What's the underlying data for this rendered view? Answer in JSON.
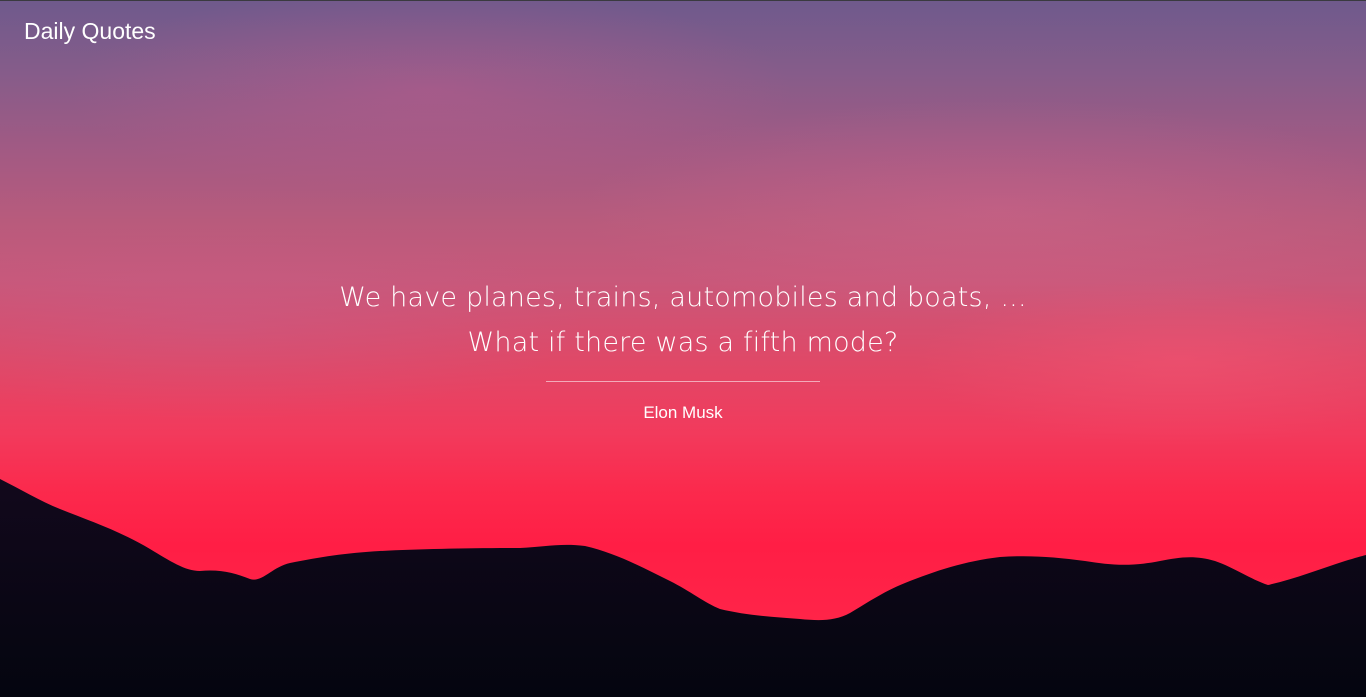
{
  "header": {
    "title": "Daily Quotes"
  },
  "quote": {
    "lines": [
      "We have planes, trains, automobiles and boats, ...",
      "What if there was a fifth mode?"
    ],
    "author": "Elon Musk"
  },
  "background": {
    "subject": "sunset-mountain-silhouette",
    "sky_top_color": "#6f5a8c",
    "sky_bottom_color": "#ff1e45",
    "mountain_color": "#070818"
  }
}
